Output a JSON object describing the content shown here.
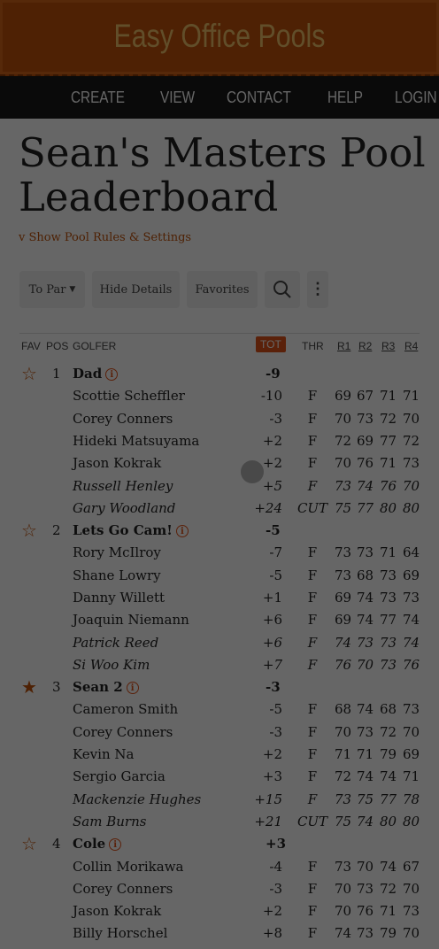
{
  "site": {
    "title": "Easy Office Pools"
  },
  "nav": [
    "CREATE",
    "VIEW",
    "CONTACT",
    "HELP",
    "LOGIN"
  ],
  "page": {
    "title_line1": "Sean's Masters Pool",
    "title_line2": "Leaderboard",
    "rules_link": "v Show Pool Rules & Settings"
  },
  "toolbar": {
    "to_par": "To Par",
    "hide_details": "Hide Details",
    "favorites": "Favorites"
  },
  "columns": [
    "FAV",
    "POS",
    "GOLFER",
    "TOT",
    "THR",
    "R1",
    "R2",
    "R3",
    "R4"
  ],
  "teams": [
    {
      "pos": "1",
      "name": "Dad",
      "tot": "-9",
      "favorite": false,
      "golfers": [
        {
          "name": "Scottie Scheffler",
          "tot": "-10",
          "thr": "F",
          "r": [
            "69",
            "67",
            "71",
            "71"
          ],
          "cut": false
        },
        {
          "name": "Corey Conners",
          "tot": "-3",
          "thr": "F",
          "r": [
            "70",
            "73",
            "72",
            "70"
          ],
          "cut": false
        },
        {
          "name": "Hideki Matsuyama",
          "tot": "+2",
          "thr": "F",
          "r": [
            "72",
            "69",
            "77",
            "72"
          ],
          "cut": false
        },
        {
          "name": "Jason Kokrak",
          "tot": "+2",
          "thr": "F",
          "r": [
            "70",
            "76",
            "71",
            "73"
          ],
          "cut": false
        },
        {
          "name": "Russell Henley",
          "tot": "+5",
          "thr": "F",
          "r": [
            "73",
            "74",
            "76",
            "70"
          ],
          "cut": true
        },
        {
          "name": "Gary Woodland",
          "tot": "+24",
          "thr": "CUT",
          "r": [
            "75",
            "77",
            "80",
            "80"
          ],
          "cut": true
        }
      ]
    },
    {
      "pos": "2",
      "name": "Lets Go Cam!",
      "tot": "-5",
      "favorite": false,
      "golfers": [
        {
          "name": "Rory McIlroy",
          "tot": "-7",
          "thr": "F",
          "r": [
            "73",
            "73",
            "71",
            "64"
          ],
          "cut": false
        },
        {
          "name": "Shane Lowry",
          "tot": "-5",
          "thr": "F",
          "r": [
            "73",
            "68",
            "73",
            "69"
          ],
          "cut": false
        },
        {
          "name": "Danny Willett",
          "tot": "+1",
          "thr": "F",
          "r": [
            "69",
            "74",
            "73",
            "73"
          ],
          "cut": false
        },
        {
          "name": "Joaquin Niemann",
          "tot": "+6",
          "thr": "F",
          "r": [
            "69",
            "74",
            "77",
            "74"
          ],
          "cut": false
        },
        {
          "name": "Patrick Reed",
          "tot": "+6",
          "thr": "F",
          "r": [
            "74",
            "73",
            "73",
            "74"
          ],
          "cut": true
        },
        {
          "name": "Si Woo Kim",
          "tot": "+7",
          "thr": "F",
          "r": [
            "76",
            "70",
            "73",
            "76"
          ],
          "cut": true
        }
      ]
    },
    {
      "pos": "3",
      "name": "Sean 2",
      "tot": "-3",
      "favorite": true,
      "golfers": [
        {
          "name": "Cameron Smith",
          "tot": "-5",
          "thr": "F",
          "r": [
            "68",
            "74",
            "68",
            "73"
          ],
          "cut": false
        },
        {
          "name": "Corey Conners",
          "tot": "-3",
          "thr": "F",
          "r": [
            "70",
            "73",
            "72",
            "70"
          ],
          "cut": false
        },
        {
          "name": "Kevin Na",
          "tot": "+2",
          "thr": "F",
          "r": [
            "71",
            "71",
            "79",
            "69"
          ],
          "cut": false
        },
        {
          "name": "Sergio Garcia",
          "tot": "+3",
          "thr": "F",
          "r": [
            "72",
            "74",
            "74",
            "71"
          ],
          "cut": false
        },
        {
          "name": "Mackenzie Hughes",
          "tot": "+15",
          "thr": "F",
          "r": [
            "73",
            "75",
            "77",
            "78"
          ],
          "cut": true
        },
        {
          "name": "Sam Burns",
          "tot": "+21",
          "thr": "CUT",
          "r": [
            "75",
            "74",
            "80",
            "80"
          ],
          "cut": true
        }
      ]
    },
    {
      "pos": "4",
      "name": "Cole",
      "tot": "+3",
      "favorite": false,
      "golfers": [
        {
          "name": "Collin Morikawa",
          "tot": "-4",
          "thr": "F",
          "r": [
            "73",
            "70",
            "74",
            "67"
          ],
          "cut": false
        },
        {
          "name": "Corey Conners",
          "tot": "-3",
          "thr": "F",
          "r": [
            "70",
            "73",
            "72",
            "70"
          ],
          "cut": false
        },
        {
          "name": "Jason Kokrak",
          "tot": "+2",
          "thr": "F",
          "r": [
            "70",
            "76",
            "71",
            "73"
          ],
          "cut": false
        },
        {
          "name": "Billy Horschel",
          "tot": "+8",
          "thr": "F",
          "r": [
            "74",
            "73",
            "79",
            "70"
          ],
          "cut": false
        }
      ]
    }
  ]
}
